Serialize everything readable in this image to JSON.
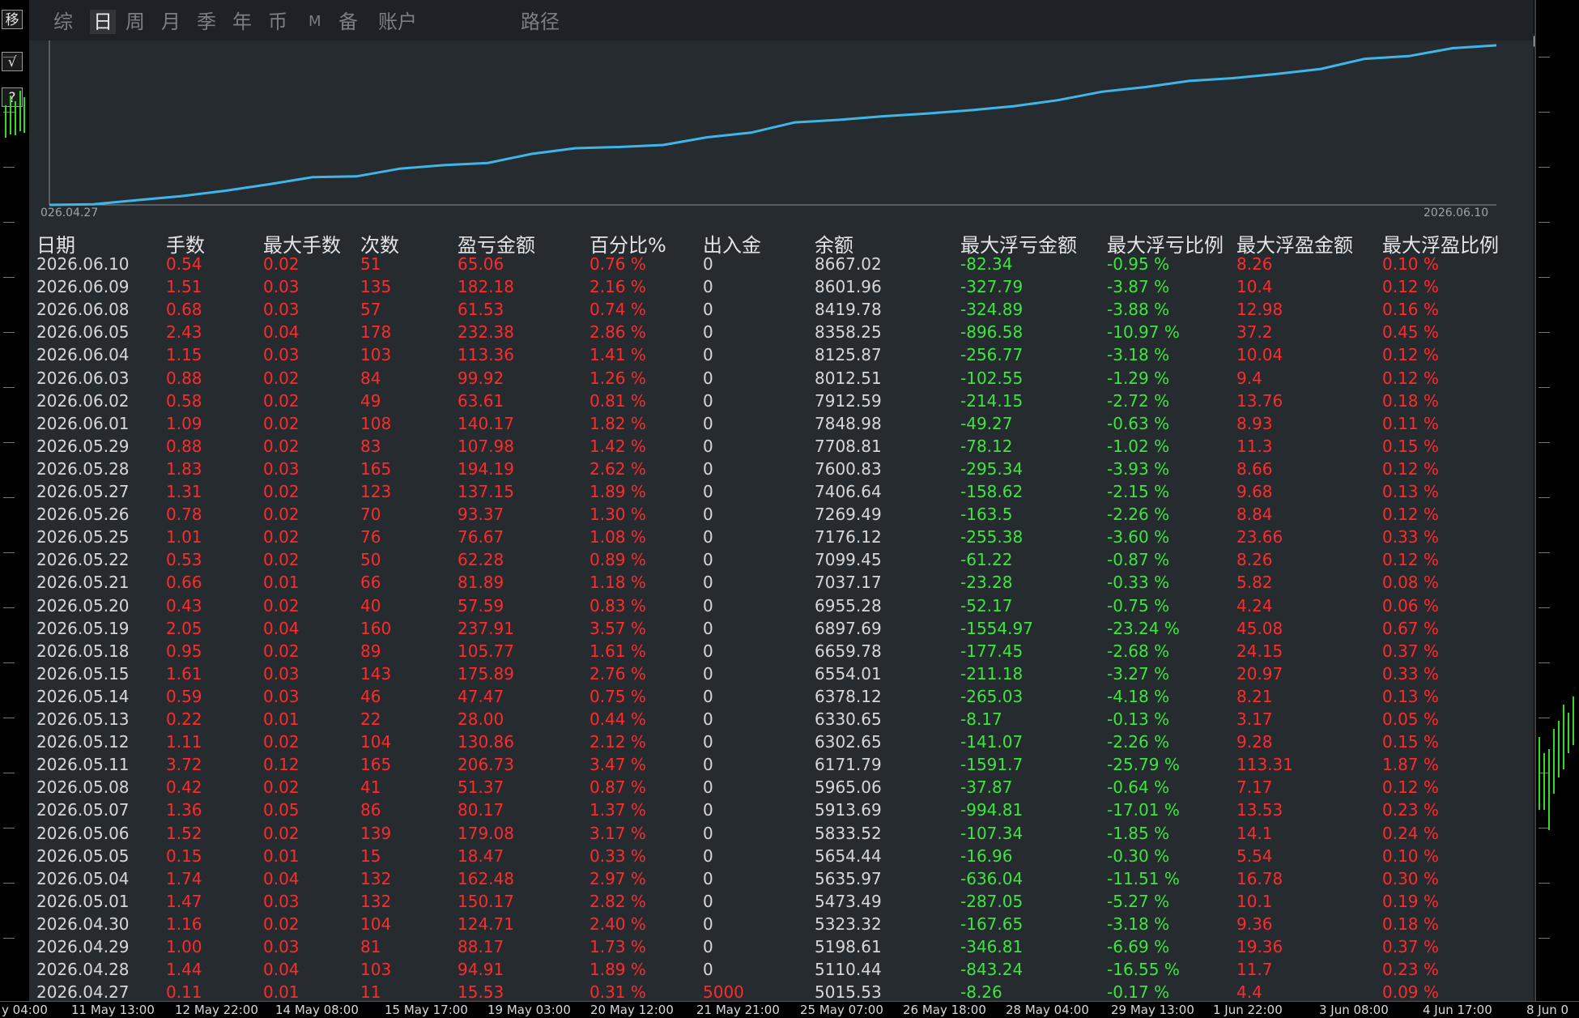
{
  "left_toolbar": {
    "top_glyph": "移",
    "check": "√",
    "help": "?"
  },
  "tabs": [
    {
      "label": "综",
      "active": false
    },
    {
      "label": "日",
      "active": true
    },
    {
      "label": "周",
      "active": false
    },
    {
      "label": "月",
      "active": false
    },
    {
      "label": "季",
      "active": false
    },
    {
      "label": "年",
      "active": false
    },
    {
      "label": "币",
      "active": false
    },
    {
      "label": "M",
      "active": false
    },
    {
      "label": "备",
      "active": false
    },
    {
      "label": "账户",
      "active": false
    },
    {
      "label": "路径",
      "active": false
    }
  ],
  "chart_data": {
    "type": "line",
    "x_start_label": "026.04.27",
    "x_end_label": "2026.06.10",
    "line_color": "#3fb6e8",
    "series_from": "table.rows.balance"
  },
  "table": {
    "headers": [
      "日期",
      "手数",
      "最大手数",
      "次数",
      "盈亏金额",
      "百分比%",
      "出入金",
      "余额",
      "最大浮亏金额",
      "最大浮亏比例",
      "最大浮盈金额",
      "最大浮盈比例"
    ],
    "rows": [
      [
        "2026.06.10",
        "0.54",
        "0.02",
        "51",
        "65.06",
        "0.76 %",
        "0",
        "8667.02",
        "-82.34",
        "-0.95 %",
        "8.26",
        "0.10 %"
      ],
      [
        "2026.06.09",
        "1.51",
        "0.03",
        "135",
        "182.18",
        "2.16 %",
        "0",
        "8601.96",
        "-327.79",
        "-3.87 %",
        "10.4",
        "0.12 %"
      ],
      [
        "2026.06.08",
        "0.68",
        "0.03",
        "57",
        "61.53",
        "0.74 %",
        "0",
        "8419.78",
        "-324.89",
        "-3.88 %",
        "12.98",
        "0.16 %"
      ],
      [
        "2026.06.05",
        "2.43",
        "0.04",
        "178",
        "232.38",
        "2.86 %",
        "0",
        "8358.25",
        "-896.58",
        "-10.97 %",
        "37.2",
        "0.45 %"
      ],
      [
        "2026.06.04",
        "1.15",
        "0.03",
        "103",
        "113.36",
        "1.41 %",
        "0",
        "8125.87",
        "-256.77",
        "-3.18 %",
        "10.04",
        "0.12 %"
      ],
      [
        "2026.06.03",
        "0.88",
        "0.02",
        "84",
        "99.92",
        "1.26 %",
        "0",
        "8012.51",
        "-102.55",
        "-1.29 %",
        "9.4",
        "0.12 %"
      ],
      [
        "2026.06.02",
        "0.58",
        "0.02",
        "49",
        "63.61",
        "0.81 %",
        "0",
        "7912.59",
        "-214.15",
        "-2.72 %",
        "13.76",
        "0.18 %"
      ],
      [
        "2026.06.01",
        "1.09",
        "0.02",
        "108",
        "140.17",
        "1.82 %",
        "0",
        "7848.98",
        "-49.27",
        "-0.63 %",
        "8.93",
        "0.11 %"
      ],
      [
        "2026.05.29",
        "0.88",
        "0.02",
        "83",
        "107.98",
        "1.42 %",
        "0",
        "7708.81",
        "-78.12",
        "-1.02 %",
        "11.3",
        "0.15 %"
      ],
      [
        "2026.05.28",
        "1.83",
        "0.03",
        "165",
        "194.19",
        "2.62 %",
        "0",
        "7600.83",
        "-295.34",
        "-3.93 %",
        "8.66",
        "0.12 %"
      ],
      [
        "2026.05.27",
        "1.31",
        "0.02",
        "123",
        "137.15",
        "1.89 %",
        "0",
        "7406.64",
        "-158.62",
        "-2.15 %",
        "9.68",
        "0.13 %"
      ],
      [
        "2026.05.26",
        "0.78",
        "0.02",
        "70",
        "93.37",
        "1.30 %",
        "0",
        "7269.49",
        "-163.5",
        "-2.26 %",
        "8.84",
        "0.12 %"
      ],
      [
        "2026.05.25",
        "1.01",
        "0.02",
        "76",
        "76.67",
        "1.08 %",
        "0",
        "7176.12",
        "-255.38",
        "-3.60 %",
        "23.66",
        "0.33 %"
      ],
      [
        "2026.05.22",
        "0.53",
        "0.02",
        "50",
        "62.28",
        "0.89 %",
        "0",
        "7099.45",
        "-61.22",
        "-0.87 %",
        "8.26",
        "0.12 %"
      ],
      [
        "2026.05.21",
        "0.66",
        "0.01",
        "66",
        "81.89",
        "1.18 %",
        "0",
        "7037.17",
        "-23.28",
        "-0.33 %",
        "5.82",
        "0.08 %"
      ],
      [
        "2026.05.20",
        "0.43",
        "0.02",
        "40",
        "57.59",
        "0.83 %",
        "0",
        "6955.28",
        "-52.17",
        "-0.75 %",
        "4.24",
        "0.06 %"
      ],
      [
        "2026.05.19",
        "2.05",
        "0.04",
        "160",
        "237.91",
        "3.57 %",
        "0",
        "6897.69",
        "-1554.97",
        "-23.24 %",
        "45.08",
        "0.67 %"
      ],
      [
        "2026.05.18",
        "0.95",
        "0.02",
        "89",
        "105.77",
        "1.61 %",
        "0",
        "6659.78",
        "-177.45",
        "-2.68 %",
        "24.15",
        "0.37 %"
      ],
      [
        "2026.05.15",
        "1.61",
        "0.03",
        "143",
        "175.89",
        "2.76 %",
        "0",
        "6554.01",
        "-211.18",
        "-3.27 %",
        "20.97",
        "0.33 %"
      ],
      [
        "2026.05.14",
        "0.59",
        "0.03",
        "46",
        "47.47",
        "0.75 %",
        "0",
        "6378.12",
        "-265.03",
        "-4.18 %",
        "8.21",
        "0.13 %"
      ],
      [
        "2026.05.13",
        "0.22",
        "0.01",
        "22",
        "28.00",
        "0.44 %",
        "0",
        "6330.65",
        "-8.17",
        "-0.13 %",
        "3.17",
        "0.05 %"
      ],
      [
        "2026.05.12",
        "1.11",
        "0.02",
        "104",
        "130.86",
        "2.12 %",
        "0",
        "6302.65",
        "-141.07",
        "-2.26 %",
        "9.28",
        "0.15 %"
      ],
      [
        "2026.05.11",
        "3.72",
        "0.12",
        "165",
        "206.73",
        "3.47 %",
        "0",
        "6171.79",
        "-1591.7",
        "-25.79 %",
        "113.31",
        "1.87 %"
      ],
      [
        "2026.05.08",
        "0.42",
        "0.02",
        "41",
        "51.37",
        "0.87 %",
        "0",
        "5965.06",
        "-37.87",
        "-0.64 %",
        "7.17",
        "0.12 %"
      ],
      [
        "2026.05.07",
        "1.36",
        "0.05",
        "86",
        "80.17",
        "1.37 %",
        "0",
        "5913.69",
        "-994.81",
        "-17.01 %",
        "13.53",
        "0.23 %"
      ],
      [
        "2026.05.06",
        "1.52",
        "0.02",
        "139",
        "179.08",
        "3.17 %",
        "0",
        "5833.52",
        "-107.34",
        "-1.85 %",
        "14.1",
        "0.24 %"
      ],
      [
        "2026.05.05",
        "0.15",
        "0.01",
        "15",
        "18.47",
        "0.33 %",
        "0",
        "5654.44",
        "-16.96",
        "-0.30 %",
        "5.54",
        "0.10 %"
      ],
      [
        "2026.05.04",
        "1.74",
        "0.04",
        "132",
        "162.48",
        "2.97 %",
        "0",
        "5635.97",
        "-636.04",
        "-11.51 %",
        "16.78",
        "0.30 %"
      ],
      [
        "2026.05.01",
        "1.47",
        "0.03",
        "132",
        "150.17",
        "2.82 %",
        "0",
        "5473.49",
        "-287.05",
        "-5.27 %",
        "10.1",
        "0.19 %"
      ],
      [
        "2026.04.30",
        "1.16",
        "0.02",
        "104",
        "124.71",
        "2.40 %",
        "0",
        "5323.32",
        "-167.65",
        "-3.18 %",
        "9.36",
        "0.18 %"
      ],
      [
        "2026.04.29",
        "1.00",
        "0.03",
        "81",
        "88.17",
        "1.73 %",
        "0",
        "5198.61",
        "-346.81",
        "-6.69 %",
        "19.36",
        "0.37 %"
      ],
      [
        "2026.04.28",
        "1.44",
        "0.04",
        "103",
        "94.91",
        "1.89 %",
        "0",
        "5110.44",
        "-843.24",
        "-16.55 %",
        "11.7",
        "0.23 %"
      ],
      [
        "2026.04.27",
        "0.11",
        "0.01",
        "11",
        "15.53",
        "0.31 %",
        "5000",
        "5015.53",
        "-8.26",
        "-0.17 %",
        "4.4",
        "0.09 %"
      ]
    ]
  },
  "time_axis": [
    "y 04:00",
    "11 May 13:00",
    "12 May 22:00",
    "14 May 08:00",
    "15 May 17:00",
    "19 May 03:00",
    "20 May 12:00",
    "21 May 21:00",
    "25 May 07:00",
    "26 May 18:00",
    "28 May 04:00",
    "29 May 13:00",
    "1 Jun 22:00",
    "3 Jun 08:00",
    "4 Jun 17:00",
    "8 Jun 0"
  ],
  "colors": {
    "panel_bg": "#262b30",
    "positive": "#ff2b2b",
    "negative": "#3ce63c",
    "neutral": "#d7d7d7",
    "line": "#3fb6e8"
  }
}
